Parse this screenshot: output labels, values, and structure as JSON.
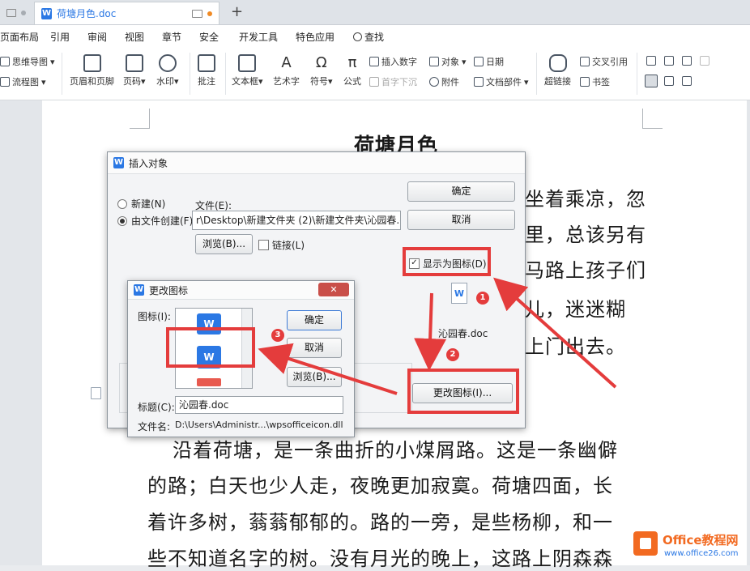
{
  "tabs": [
    {
      "label": ""
    },
    {
      "label": "荷塘月色.doc"
    }
  ],
  "new_tab": "+",
  "menu": [
    "页面布局",
    "引用",
    "审阅",
    "视图",
    "章节",
    "安全",
    "开发工具",
    "特色应用",
    "查找"
  ],
  "ribbon": {
    "mindmap": "思维导图",
    "flowchart": "流程图",
    "header_footer": "页眉和页脚",
    "page_number": "页码",
    "watermark": "水印",
    "comment": "批注",
    "textbox": "文本框",
    "wordart": "艺术字",
    "symbol": "符号",
    "formula": "公式",
    "insert_number": "插入数字",
    "object": "对象",
    "date": "日期",
    "drop_cap": "首字下沉",
    "attachment": "附件",
    "doc_parts": "文档部件",
    "hyperlink": "超链接",
    "cross_ref": "交叉引用",
    "bookmark": "书签"
  },
  "document": {
    "title": "荷塘月色",
    "lines": [
      "坐着乘凉，忽",
      "里，总该另有",
      "马路上孩子们",
      "儿，迷迷糊",
      "上门出去。",
      "沿着荷塘，是一条曲折的小煤屑路。这是一条幽僻",
      "的路；白天也少人走，夜晚更加寂寞。荷塘四面，长",
      "着许多树，蓊蓊郁郁的。路的一旁，是些杨柳，和一",
      "些不知道名字的树。没有月光的晚上，这路上阴森森"
    ]
  },
  "insert_dialog": {
    "title": "插入对象",
    "new_label": "新建(N)",
    "from_file_label": "由文件创建(F)",
    "file_label": "文件(E):",
    "file_value": "r\\Desktop\\新建文件夹 (2)\\新建文件夹\\沁园春.doc",
    "browse": "浏览(B)...",
    "link": "链接(L)",
    "ok": "确定",
    "cancel": "取消",
    "display_as_icon": "显示为图标(D)",
    "icon_caption": "沁园春.doc",
    "change_icon": "更改图标(I)..."
  },
  "change_icon_dialog": {
    "title": "更改图标",
    "icon_label": "图标(I):",
    "ok": "确定",
    "cancel": "取消",
    "browse": "浏览(B)...",
    "caption_label": "标题(C):",
    "caption_value": "沁园春.doc",
    "filename_label": "文件名:",
    "filename_value": "D:\\Users\\Administr...\\wpsofficeicon.dll",
    "close": "✕"
  },
  "annotations": [
    "1",
    "2",
    "3"
  ],
  "colors": {
    "red": "#e43c3c",
    "wps_blue": "#2b78e4",
    "logo_orange": "#f26a21"
  },
  "logo": {
    "main": "Office教程网",
    "sub": "www.office26.com"
  }
}
